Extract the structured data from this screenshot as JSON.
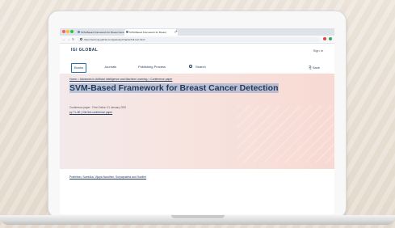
{
  "browser": {
    "tabs": [
      {
        "label": "SVM-Based Framework for Breast Cancer"
      },
      {
        "label": "SVM-Based Framework for Breast"
      }
    ],
    "url": "https://www.igi-global.com/gateway/chapter/full-text-html/"
  },
  "site": {
    "brand": "IGI GLOBAL",
    "signin": "Sign In",
    "nav": [
      "Books",
      "Journals",
      "Publishing Process"
    ],
    "search_label": "Search",
    "save_label": "Save"
  },
  "hero": {
    "breadcrumb": "Home > Advances in Artificial Intelligence and Machine Learning > Conference paper",
    "title": "SVM-Based Framework for Breast Cancer Detection",
    "meta": "Conference paper · First Online: 01 January 2022",
    "doi": "pp 71–80 | Cite this conference paper"
  },
  "authors": "Prathiban, Sumbika, Vijaya Nandhini, Suryaprabha and Savithri"
}
